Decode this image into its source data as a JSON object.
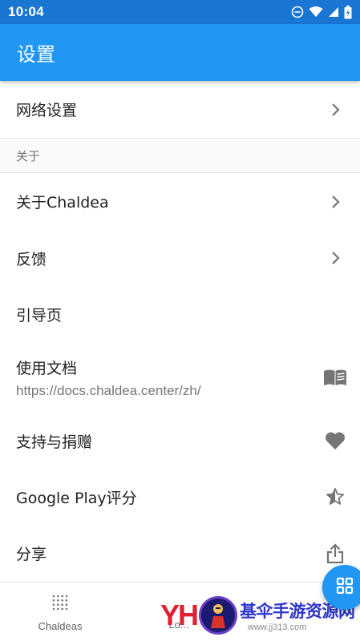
{
  "status_bar": {
    "time": "10:04",
    "icons": [
      "do-not-disturb-icon",
      "wifi-icon",
      "signal-icon",
      "battery-icon"
    ]
  },
  "app_bar": {
    "title": "设置"
  },
  "settings": {
    "network": {
      "label": "网络设置",
      "icon": "chevron-right-icon"
    },
    "section_about": {
      "header": "关于"
    },
    "about": {
      "label": "关于Chaldea",
      "icon": "chevron-right-icon"
    },
    "feedback": {
      "label": "反馈",
      "icon": "chevron-right-icon"
    },
    "guide": {
      "label": "引导页"
    },
    "docs": {
      "label": "使用文档",
      "subtitle": "https://docs.chaldea.center/zh/",
      "icon": "book-icon"
    },
    "support": {
      "label": "支持与捐赠",
      "icon": "heart-icon"
    },
    "rate": {
      "label": "Google Play评分",
      "icon": "star-half-icon"
    },
    "share": {
      "label": "分享",
      "icon": "share-icon"
    }
  },
  "bottom_nav": {
    "items": [
      {
        "label": "Chaldeas",
        "icon": "dots-grid-icon"
      },
      {
        "label": "Lo...",
        "icon": ""
      }
    ]
  },
  "fab": {
    "icon": "apps-grid-icon"
  },
  "watermark": {
    "logo": "YH",
    "title": "基伞手游资源网",
    "url": "www.jj313.com"
  },
  "colors": {
    "status_bar": "#1976d2",
    "app_bar": "#2196f3",
    "icon_gray": "#757575",
    "divider": "#e0e0e0",
    "watermark_red": "#e0202e",
    "watermark_blue": "#2d35c9"
  }
}
